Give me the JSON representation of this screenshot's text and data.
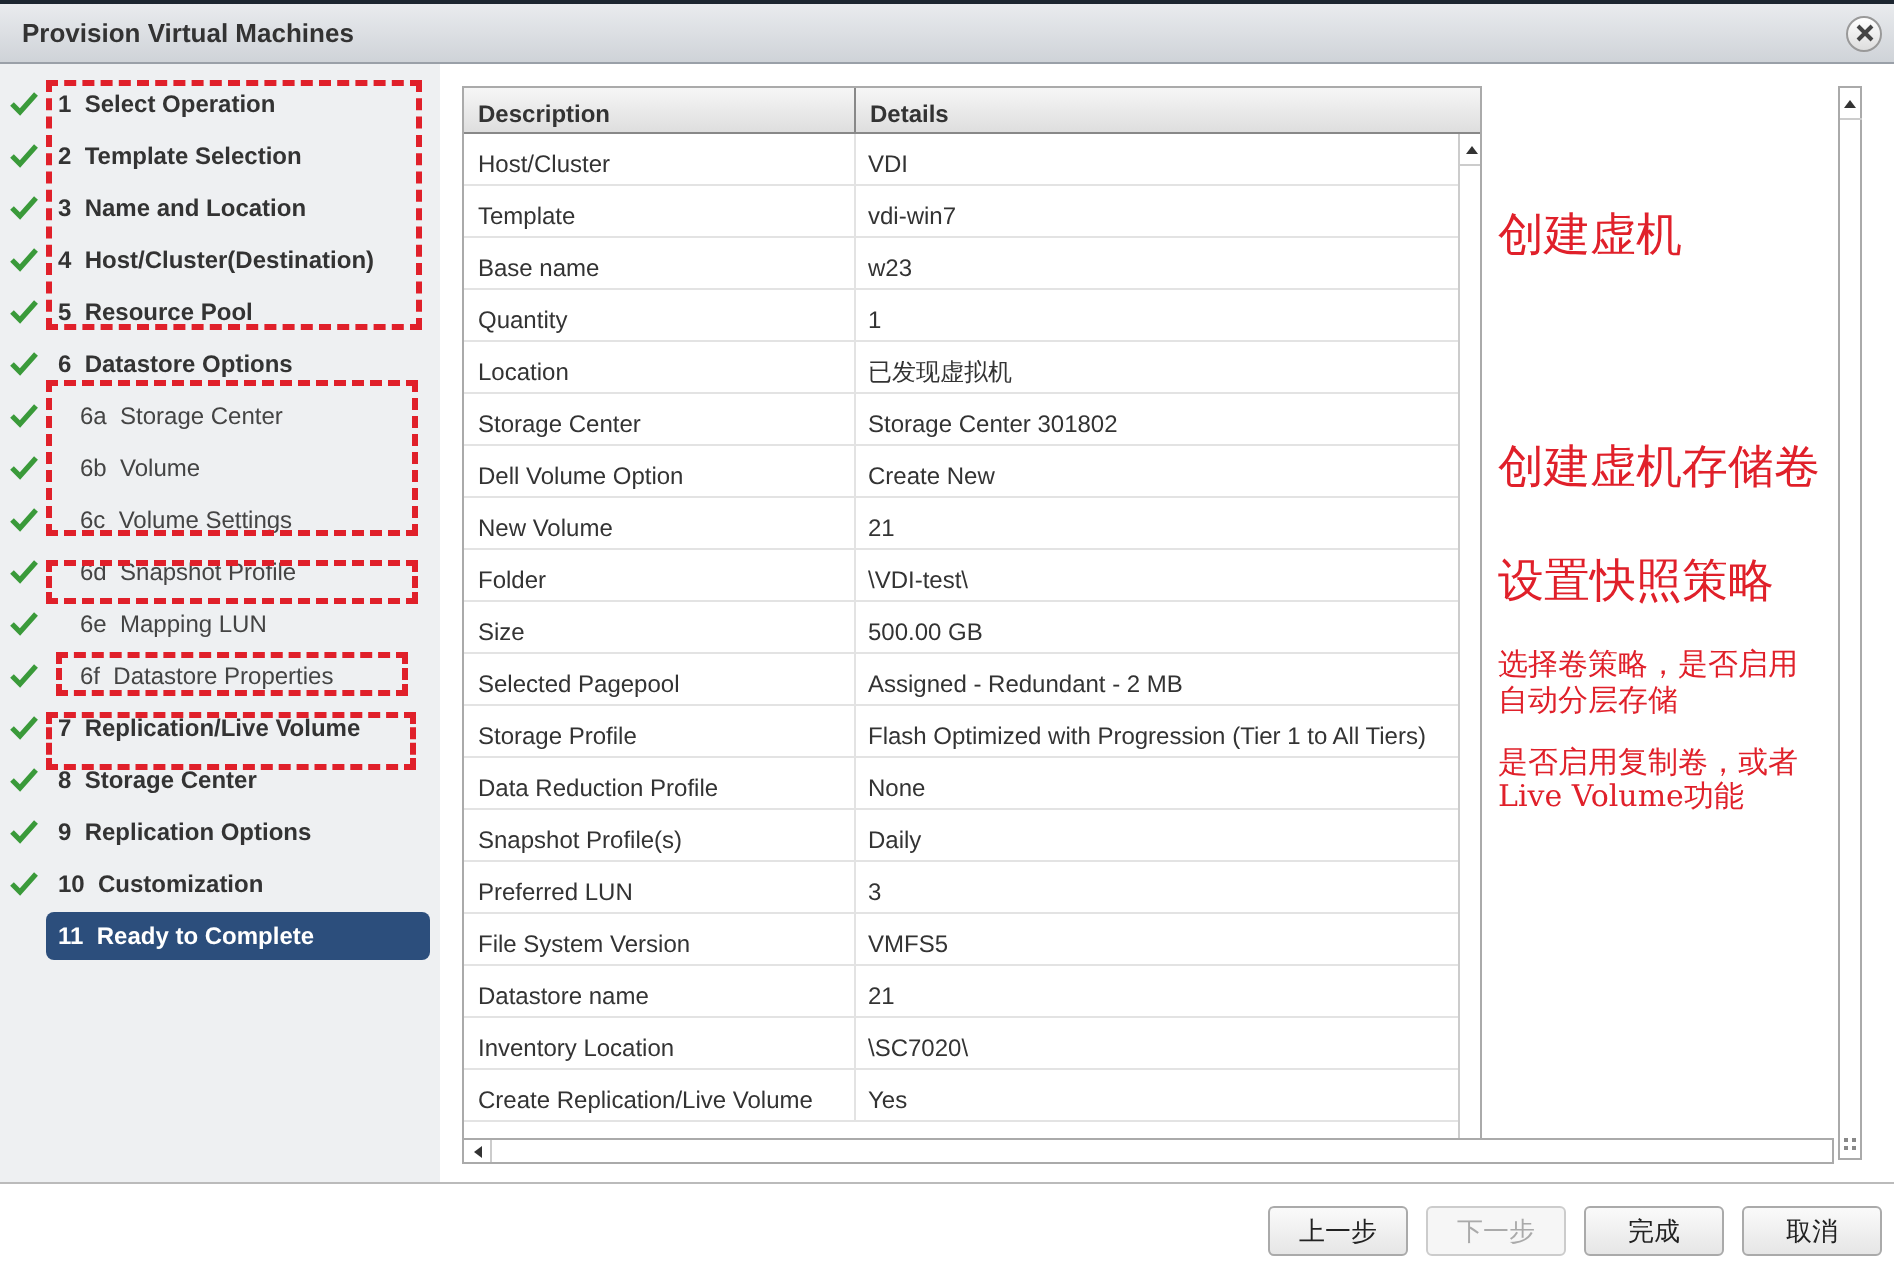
{
  "window": {
    "title": "Provision Virtual Machines"
  },
  "steps": [
    {
      "number": "1",
      "label": "Select Operation",
      "done": true,
      "selected": false
    },
    {
      "number": "2",
      "label": "Template Selection",
      "done": true,
      "selected": false
    },
    {
      "number": "3",
      "label": "Name and Location",
      "done": true,
      "selected": false
    },
    {
      "number": "4",
      "label": "Host/Cluster(Destination)",
      "done": true,
      "selected": false
    },
    {
      "number": "5",
      "label": "Resource Pool",
      "done": true,
      "selected": false
    },
    {
      "number": "6",
      "label": "Datastore Options",
      "done": true,
      "selected": false,
      "children": [
        {
          "number": "6a",
          "label": "Storage Center",
          "done": true,
          "selected": false
        },
        {
          "number": "6b",
          "label": "Volume",
          "done": true,
          "selected": false
        },
        {
          "number": "6c",
          "label": "Volume Settings",
          "done": true,
          "selected": false
        },
        {
          "number": "6d",
          "label": "Snapshot Profile",
          "done": true,
          "selected": false
        },
        {
          "number": "6e",
          "label": "Mapping LUN",
          "done": true,
          "selected": false
        },
        {
          "number": "6f",
          "label": "Datastore Properties",
          "done": true,
          "selected": false
        }
      ]
    },
    {
      "number": "7",
      "label": "Replication/Live Volume",
      "done": true,
      "selected": false
    },
    {
      "number": "8",
      "label": "Storage Center",
      "done": true,
      "selected": false
    },
    {
      "number": "9",
      "label": "Replication Options",
      "done": true,
      "selected": false
    },
    {
      "number": "10",
      "label": "Customization",
      "done": true,
      "selected": false
    },
    {
      "number": "11",
      "label": "Ready to Complete",
      "done": false,
      "selected": true
    }
  ],
  "table": {
    "columns": [
      "Description",
      "Details"
    ],
    "rows": [
      [
        "Host/Cluster",
        "VDI"
      ],
      [
        "Template",
        "vdi-win7"
      ],
      [
        "Base name",
        "w23"
      ],
      [
        "Quantity",
        "1"
      ],
      [
        "Location",
        "已发现虚拟机"
      ],
      [
        "Storage Center",
        "Storage Center 301802"
      ],
      [
        "Dell Volume Option",
        "Create New"
      ],
      [
        "New Volume",
        "21"
      ],
      [
        "Folder",
        "\\VDI-test\\"
      ],
      [
        "Size",
        "500.00 GB"
      ],
      [
        "Selected Pagepool",
        "Assigned - Redundant - 2 MB"
      ],
      [
        "Storage Profile",
        "Flash Optimized with Progression (Tier 1 to All Tiers)"
      ],
      [
        "Data Reduction Profile",
        "None"
      ],
      [
        "Snapshot Profile(s)",
        "Daily"
      ],
      [
        "Preferred LUN",
        "3"
      ],
      [
        "File System Version",
        "VMFS5"
      ],
      [
        "Datastore name",
        "21"
      ],
      [
        "Inventory Location",
        "\\SC7020\\"
      ],
      [
        "Create Replication/Live Volume",
        "Yes"
      ]
    ]
  },
  "annotations": [
    {
      "text": "创建虚机",
      "kind": "large"
    },
    {
      "text": "创建虚机存储卷",
      "kind": "large"
    },
    {
      "text": "设置快照策略",
      "kind": "large"
    },
    {
      "text": "选择卷策略，是否启用自动分层存储",
      "kind": "small"
    },
    {
      "text": "是否启用复制卷，或者Live Volume功能",
      "kind": "small"
    }
  ],
  "buttons": [
    {
      "label": "上一步",
      "disabled": false
    },
    {
      "label": "下一步",
      "disabled": true
    },
    {
      "label": "完成",
      "disabled": false
    },
    {
      "label": "取消",
      "disabled": false
    }
  ]
}
